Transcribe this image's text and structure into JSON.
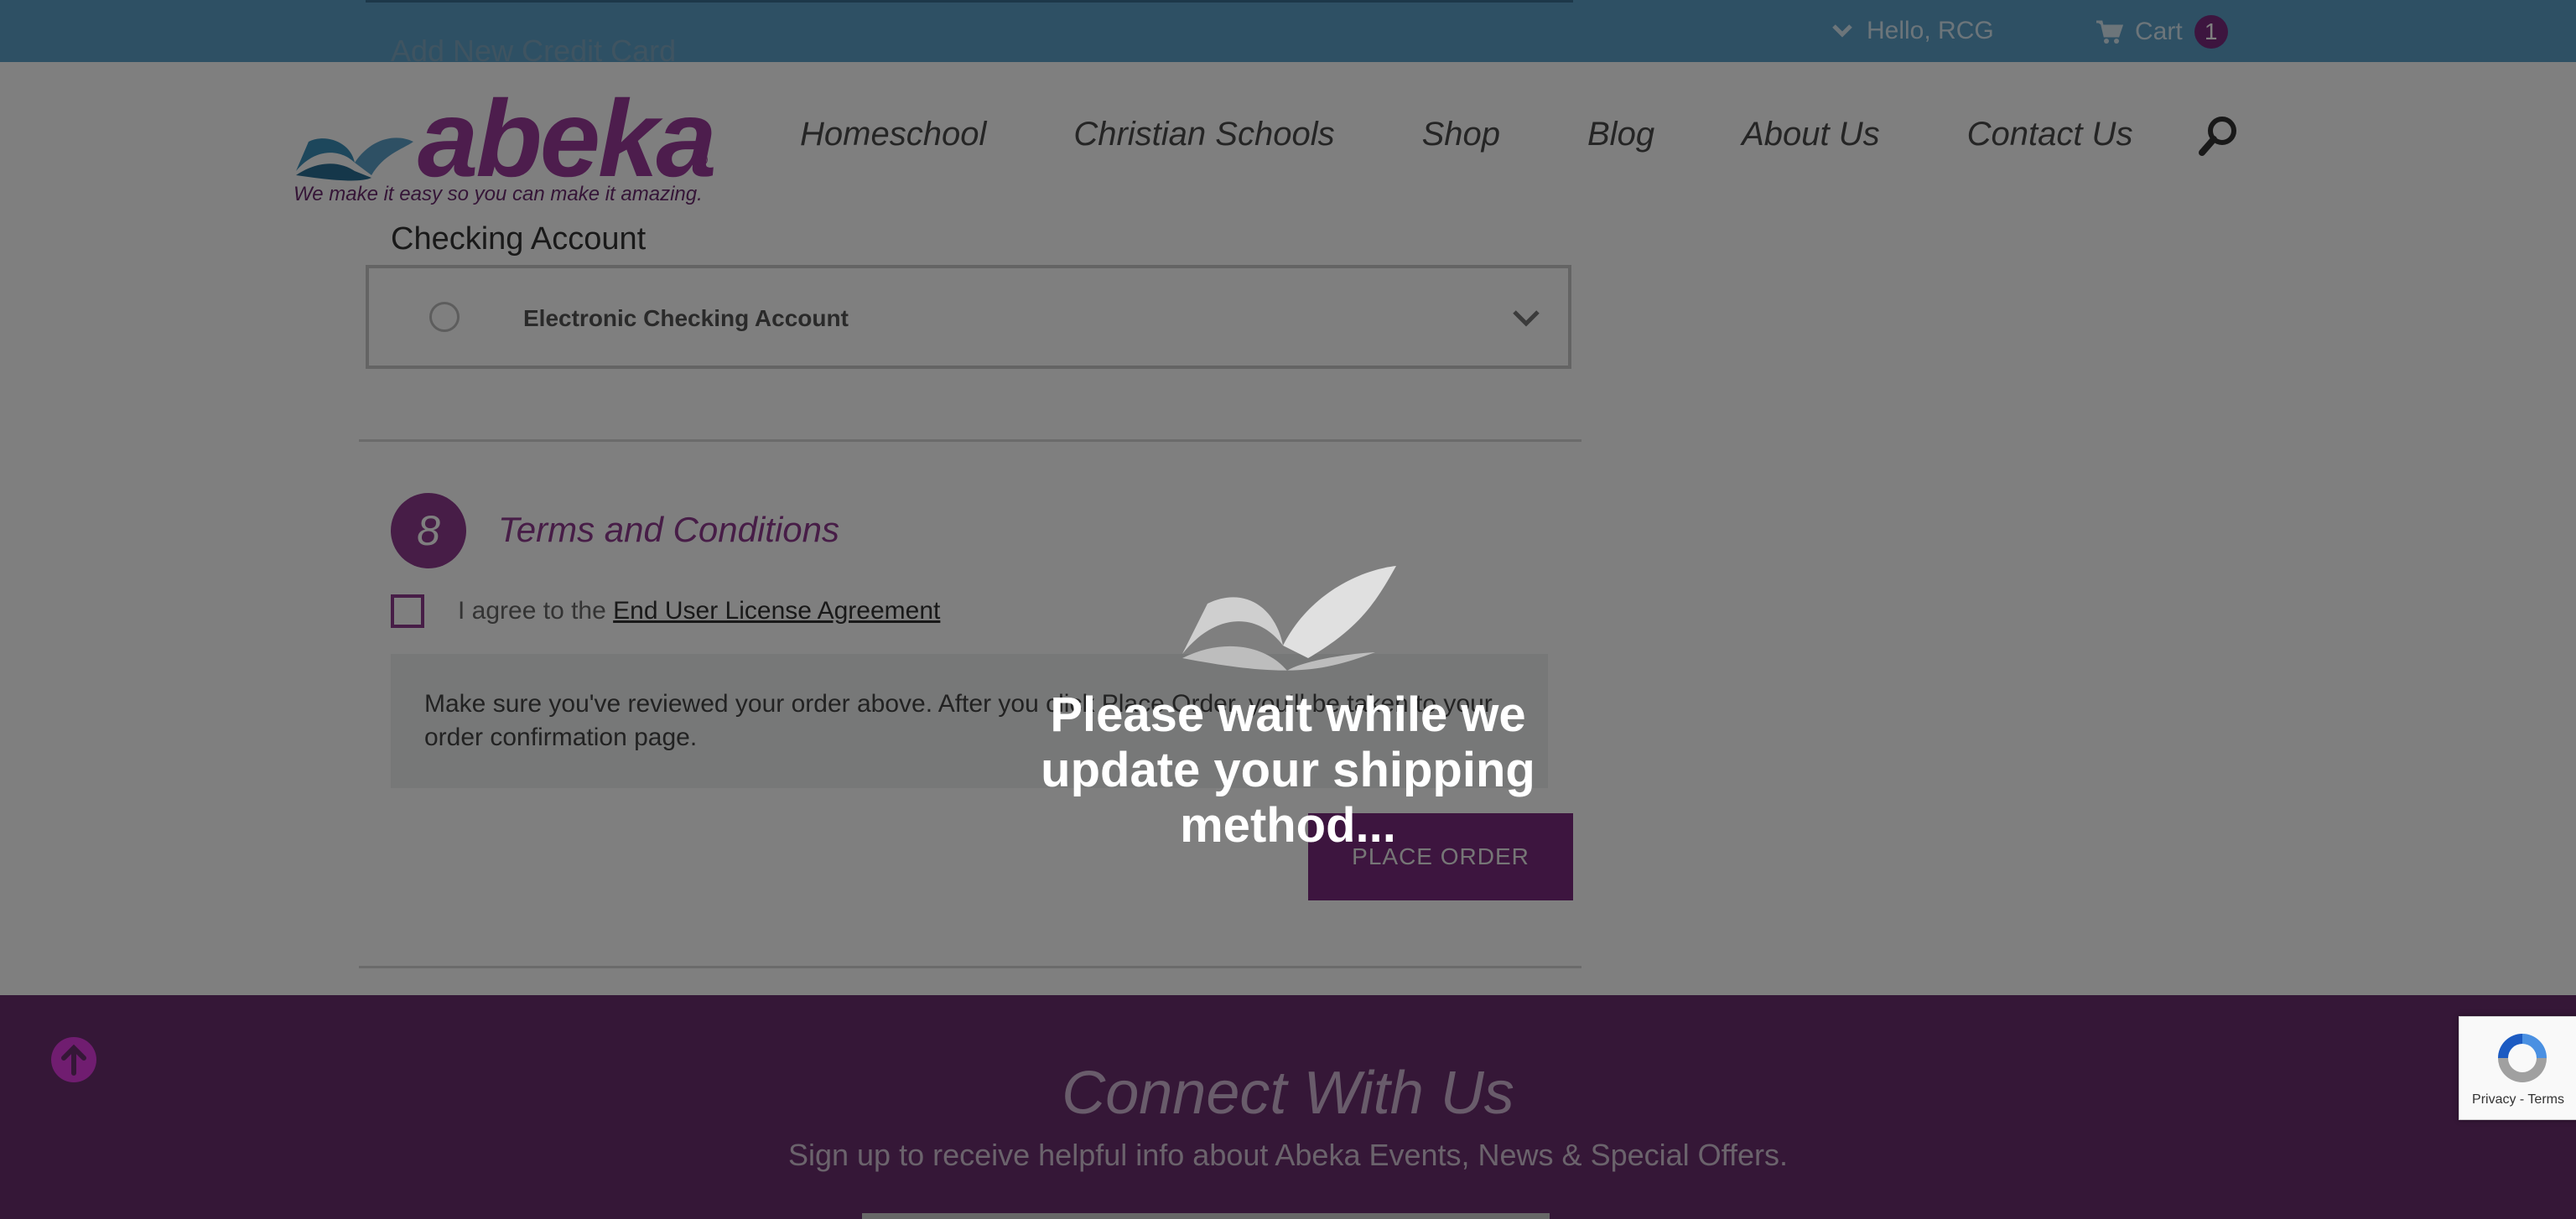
{
  "topbar": {
    "previous_field": "Add New Credit Card",
    "greeting": "Hello, RCG",
    "cart_label": "Cart",
    "cart_count": "1"
  },
  "header": {
    "logo_text": "abeka",
    "logo_reg": "®",
    "tagline": "We make it easy so you can make it amazing.",
    "nav": [
      "Homeschool",
      "Christian Schools",
      "Shop",
      "Blog",
      "About Us",
      "Contact Us"
    ]
  },
  "checkout": {
    "checking_heading": "Checking Account",
    "checking_option": "Electronic Checking Account",
    "step_number": "8",
    "step_title": "Terms and Conditions",
    "agree_prefix": "I agree to the",
    "agree_link": "End User License Agreement",
    "notice": "Make sure you've reviewed your order above. After you click Place Order, you'll be taken to your order confirmation page.",
    "place_order": "PLACE ORDER"
  },
  "footer": {
    "connect_title": "Connect With Us",
    "signup_text": "Sign up to receive helpful info about Abeka Events, News & Special Offers."
  },
  "recaptcha": {
    "links": "Privacy - Terms"
  },
  "overlay": {
    "message": "Please wait while we update your shipping method..."
  },
  "colors": {
    "brand_purple": "#8e3a8e",
    "topbar_blue": "#5ca0c9",
    "footer_purple": "#6a2f6e"
  }
}
